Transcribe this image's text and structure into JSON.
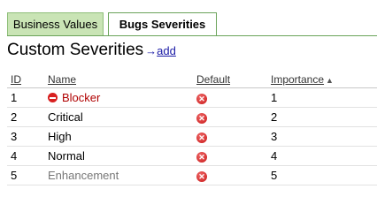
{
  "tabs": [
    {
      "label": "Business Values",
      "active": false
    },
    {
      "label": "Bugs Severities",
      "active": true
    }
  ],
  "heading": {
    "title": "Custom Severities",
    "arrow": "→",
    "add_label": "add"
  },
  "table": {
    "columns": {
      "id": "ID",
      "name": "Name",
      "default": "Default",
      "importance": "Importance"
    },
    "rows": [
      {
        "id": "1",
        "name": "Blocker",
        "default_icon": "x-circle-icon",
        "importance": "1"
      },
      {
        "id": "2",
        "name": "Critical",
        "default_icon": "x-circle-icon",
        "importance": "2"
      },
      {
        "id": "3",
        "name": "High",
        "default_icon": "x-circle-icon",
        "importance": "3"
      },
      {
        "id": "4",
        "name": "Normal",
        "default_icon": "x-circle-icon",
        "importance": "4"
      },
      {
        "id": "5",
        "name": "Enhancement",
        "default_icon": "x-circle-icon",
        "importance": "5"
      }
    ]
  },
  "colors": {
    "tab_inactive_bg": "#c9e4b5",
    "tab_border": "#6aa35a",
    "link": "#1a1aa6",
    "blocker_text": "#b00000",
    "enhancement_text": "#777777",
    "default_icon": "#d82020"
  }
}
